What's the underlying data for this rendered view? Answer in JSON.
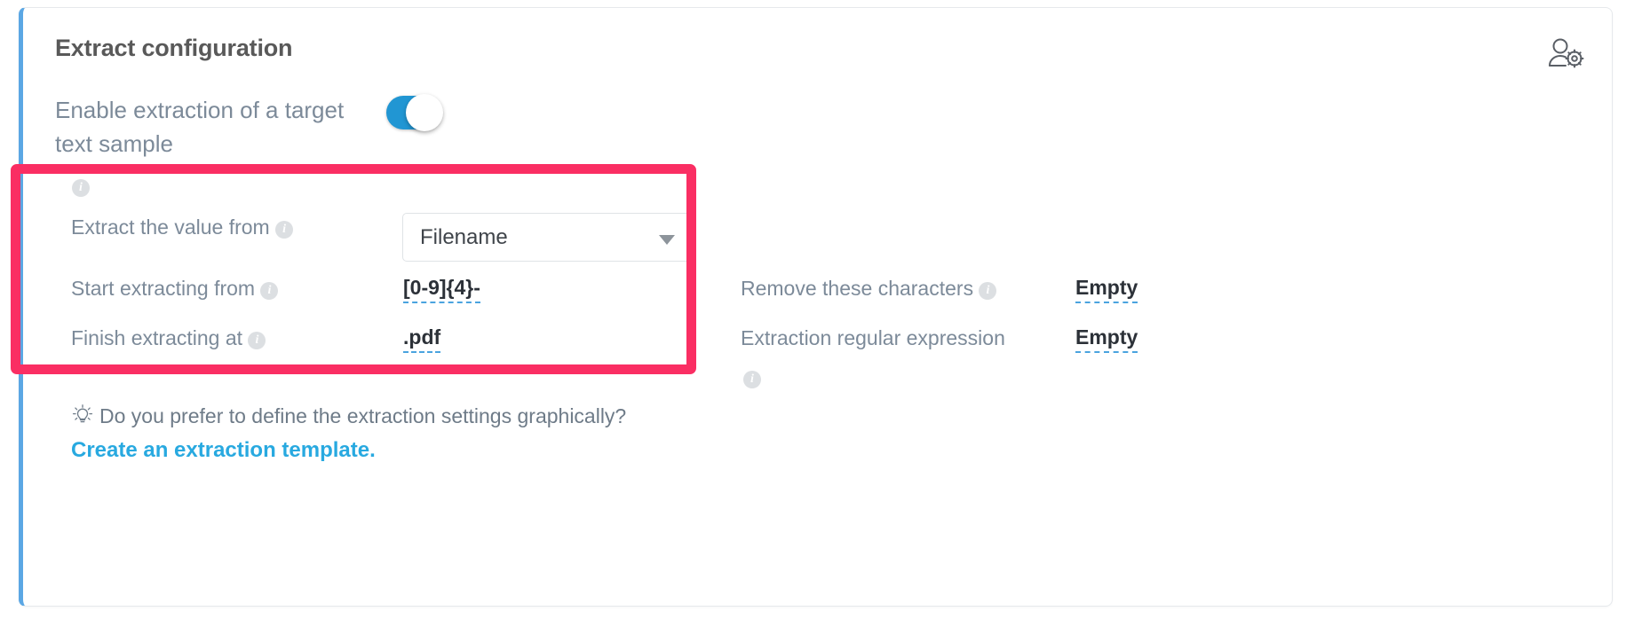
{
  "card": {
    "title": "Extract configuration",
    "accent_border_color": "#5ba7e4",
    "header_icon_name": "user-settings-icon"
  },
  "toggle": {
    "label": "Enable extraction of a target text sample",
    "state": "on",
    "on_color": "#2196d3"
  },
  "highlight": {
    "color": "#fa2e63"
  },
  "fields": {
    "extract_from": {
      "label": "Extract the value from",
      "info": "i",
      "control": "select",
      "value": "Filename"
    },
    "start_extracting": {
      "label": "Start extracting from",
      "info": "i",
      "value": "[0-9]{4}-"
    },
    "finish_extracting": {
      "label": "Finish extracting at",
      "info": "i",
      "value": ".pdf"
    },
    "remove_characters": {
      "label": "Remove these characters",
      "info": "i",
      "value": "Empty"
    },
    "extraction_regex": {
      "label": "Extraction regular expression",
      "info": "i",
      "value": "Empty"
    }
  },
  "hint": {
    "text": "Do you prefer to define the extraction settings graphically?",
    "link": "Create an extraction template.",
    "icon_name": "lightbulb-icon"
  }
}
